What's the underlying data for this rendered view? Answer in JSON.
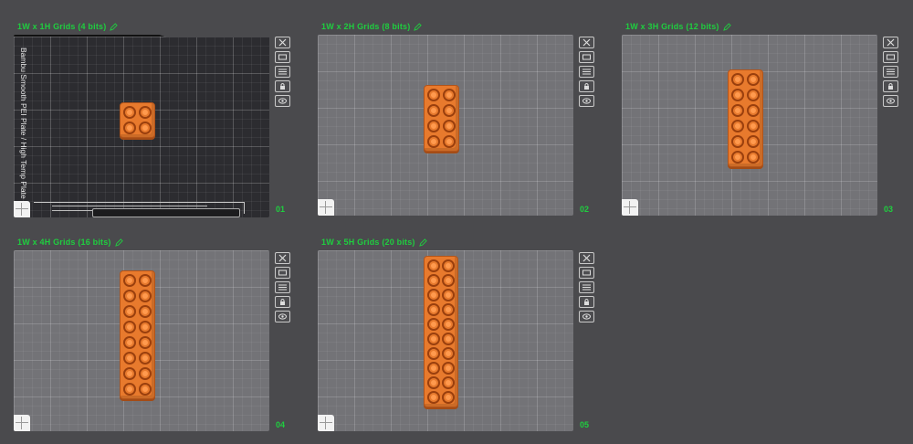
{
  "plates": [
    {
      "title": "1W x 1H Grids (4 bits)",
      "number": "01",
      "rows": 1,
      "selected": true,
      "bed_label": "Bambu Smooth PEI Plate / High Temp Plate"
    },
    {
      "title": "1W x 2H Grids (8 bits)",
      "number": "02",
      "rows": 2,
      "selected": false
    },
    {
      "title": "1W x 3H Grids (12 bits)",
      "number": "03",
      "rows": 3,
      "selected": false
    },
    {
      "title": "1W x 4H Grids (16 bits)",
      "number": "04",
      "rows": 4,
      "selected": false
    },
    {
      "title": "1W x 5H Grids (20 bits)",
      "number": "05",
      "rows": 5,
      "selected": false
    }
  ],
  "tool_icons": [
    "close-icon",
    "auto-orient-icon",
    "arrange-icon",
    "lock-icon",
    "preview-eye-icon"
  ],
  "colors": {
    "accent": "#1fce3f",
    "part": "#e87a2d",
    "bed": "#737377",
    "bed_selected": "#2c2c30"
  }
}
